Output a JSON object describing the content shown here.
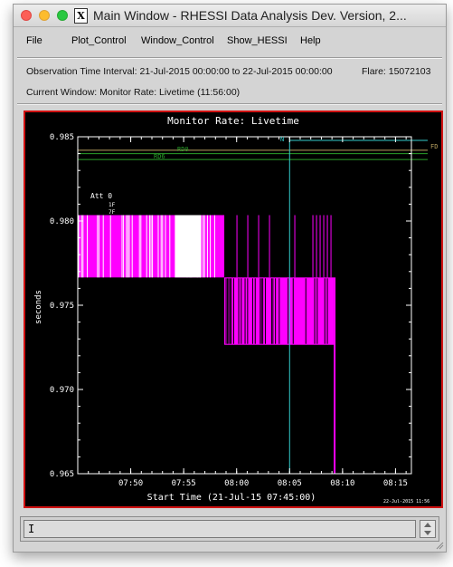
{
  "window": {
    "title": "Main Window - RHESSI Data Analysis Dev. Version, 2..."
  },
  "menu": {
    "items": [
      "File",
      "Plot_Control",
      "Window_Control",
      "Show_HESSI",
      "Help"
    ]
  },
  "info": {
    "interval": "Observation Time Interval: 21-Jul-2015 00:00:00  to  22-Jul-2015 00:00:00",
    "flare": "Flare: 15072103",
    "current_window": "Current Window: Monitor Rate:  Livetime  (11:56:00)"
  },
  "command_line": {
    "value": "I"
  },
  "colors": {
    "plot_background": "#000000",
    "frame_border": "#d01212",
    "magenta_series": "#ff00ff",
    "cyan_marker": "#33cccc",
    "green_lines": "#2aa02a",
    "tan_line": "#b8a060"
  },
  "chart_data": {
    "type": "line",
    "title": "Monitor Rate:  Livetime",
    "xlabel": "Start Time (21-Jul-15 07:45:00)",
    "ylabel": "seconds",
    "x_ticks": [
      "07:50",
      "07:55",
      "08:00",
      "08:05",
      "08:10",
      "08:15"
    ],
    "y_ticks": [
      "0.965",
      "0.970",
      "0.975",
      "0.980",
      "0.985"
    ],
    "ylim": [
      0.965,
      0.985
    ],
    "xlim": [
      "07:45:00",
      "08:16:30"
    ],
    "timestamp": "22-Jul-2015 11:56",
    "annotations": {
      "att": "Att 0",
      "att_1": "1F",
      "att_2": "7F",
      "n_marker": "N",
      "rd0": "RD0",
      "rd6": "RD6",
      "fd": "FD"
    },
    "reference_lines": [
      {
        "label": "FD",
        "y": 0.9842
      },
      {
        "label": "RD0",
        "y": 0.984
      },
      {
        "label": "RD6",
        "y": 0.98365
      }
    ],
    "marker_time": "08:05:00",
    "series": [
      {
        "name": "",
        "segments": [
          {
            "start": "07:45:00",
            "end": "07:58:50",
            "low": 0.97665,
            "high": 0.98035
          },
          {
            "start": "07:58:50",
            "end": "08:09:10",
            "low": 0.97265,
            "high": 0.97665
          },
          {
            "start": "08:09:10",
            "end": "08:09:20",
            "low": 0.965,
            "high": 0.97665
          }
        ]
      }
    ]
  }
}
